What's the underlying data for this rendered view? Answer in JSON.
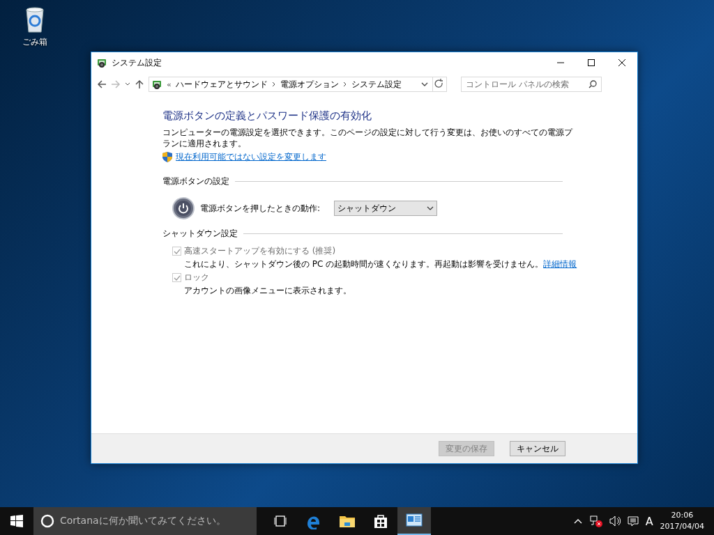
{
  "desktop_icons": [
    {
      "label": "ごみ箱"
    }
  ],
  "window": {
    "title": "システム設定",
    "address": {
      "overflow_marker": "«",
      "crumbs": [
        "ハードウェアとサウンド",
        "電源オプション",
        "システム設定"
      ]
    },
    "search": {
      "placeholder": "コントロール パネルの検索"
    },
    "heading": "電源ボタンの定義とパスワード保護の有効化",
    "description": "コンピューターの電源設定を選択できます。このページの設定に対して行う変更は、お使いのすべての電源プランに適用されます。",
    "admin_link": "現在利用可能ではない設定を変更します",
    "power_section": {
      "title": "電源ボタンの設定",
      "label": "電源ボタンを押したときの動作:",
      "dropdown_value": "シャットダウン"
    },
    "shutdown_section": {
      "title": "シャットダウン設定",
      "options": [
        {
          "label": "高速スタートアップを有効にする (推奨)",
          "checked": true,
          "disabled": true,
          "description": "これにより、シャットダウン後の PC の起動時間が速くなります。再起動は影響を受けません。",
          "link": "詳細情報"
        },
        {
          "label": "ロック",
          "checked": true,
          "disabled": true,
          "description": "アカウントの画像メニューに表示されます。"
        }
      ]
    },
    "buttons": [
      {
        "label": "変更の保存",
        "disabled": true
      },
      {
        "label": "キャンセル",
        "disabled": false
      }
    ]
  },
  "taskbar": {
    "search_placeholder": "Cortanaに何か聞いてみてください。",
    "apps": [
      {
        "kind": "taskview",
        "selected": false
      },
      {
        "kind": "edge",
        "selected": false
      },
      {
        "kind": "explorer",
        "selected": false
      },
      {
        "kind": "store",
        "selected": false
      },
      {
        "kind": "controlpanel",
        "selected": true
      }
    ],
    "ime": "A",
    "time": "20:06",
    "date": "2017/04/04"
  }
}
